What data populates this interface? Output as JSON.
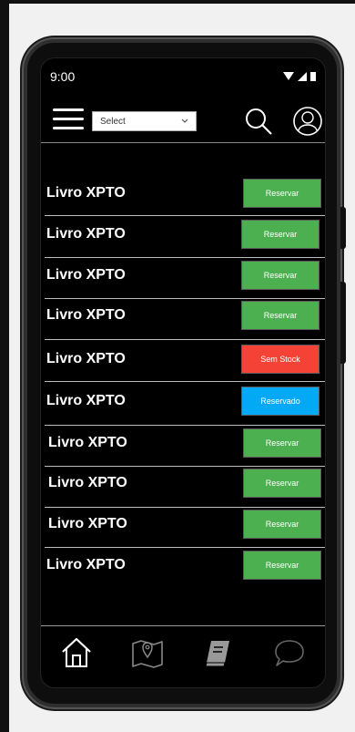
{
  "status_bar": {
    "time": "9:00"
  },
  "header": {
    "select": {
      "selected": "Select"
    }
  },
  "books": [
    {
      "title": "Livro XPTO",
      "action": "Reservar",
      "status": "available"
    },
    {
      "title": "Livro XPTO",
      "action": "Reservar",
      "status": "available"
    },
    {
      "title": "Livro XPTO",
      "action": "Reservar",
      "status": "available"
    },
    {
      "title": "Livro XPTO",
      "action": "Reservar",
      "status": "available"
    },
    {
      "title": "Livro XPTO",
      "action": "Sem Stock",
      "status": "out-of-stock"
    },
    {
      "title": "Livro XPTO",
      "action": "Reservado",
      "status": "reserved"
    },
    {
      "title": "Livro XPTO",
      "action": "Reservar",
      "status": "available"
    },
    {
      "title": "Livro XPTO",
      "action": "Reservar",
      "status": "available"
    },
    {
      "title": "Livro XPTO",
      "action": "Reservar",
      "status": "available"
    },
    {
      "title": "Livro XPTO",
      "action": "Reservar",
      "status": "available"
    }
  ],
  "status_colors": {
    "available": "#4caf50",
    "out-of-stock": "#f44336",
    "reserved": "#03a9f4"
  },
  "bottom_nav": [
    {
      "icon": "home-icon",
      "active": true
    },
    {
      "icon": "map-icon",
      "active": false
    },
    {
      "icon": "book-icon",
      "active": false
    },
    {
      "icon": "chat-icon",
      "active": false
    }
  ]
}
